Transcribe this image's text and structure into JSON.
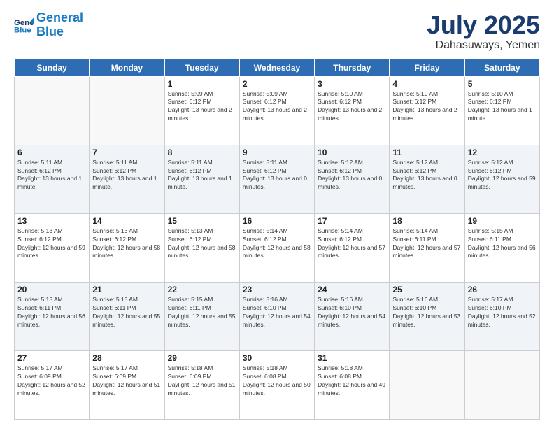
{
  "logo": {
    "line1": "General",
    "line2": "Blue"
  },
  "title": "July 2025",
  "subtitle": "Dahasuways, Yemen",
  "days_header": [
    "Sunday",
    "Monday",
    "Tuesday",
    "Wednesday",
    "Thursday",
    "Friday",
    "Saturday"
  ],
  "weeks": [
    [
      {
        "num": "",
        "info": ""
      },
      {
        "num": "",
        "info": ""
      },
      {
        "num": "1",
        "info": "Sunrise: 5:09 AM\nSunset: 6:12 PM\nDaylight: 13 hours and 2 minutes."
      },
      {
        "num": "2",
        "info": "Sunrise: 5:09 AM\nSunset: 6:12 PM\nDaylight: 13 hours and 2 minutes."
      },
      {
        "num": "3",
        "info": "Sunrise: 5:10 AM\nSunset: 6:12 PM\nDaylight: 13 hours and 2 minutes."
      },
      {
        "num": "4",
        "info": "Sunrise: 5:10 AM\nSunset: 6:12 PM\nDaylight: 13 hours and 2 minutes."
      },
      {
        "num": "5",
        "info": "Sunrise: 5:10 AM\nSunset: 6:12 PM\nDaylight: 13 hours and 1 minute."
      }
    ],
    [
      {
        "num": "6",
        "info": "Sunrise: 5:11 AM\nSunset: 6:12 PM\nDaylight: 13 hours and 1 minute."
      },
      {
        "num": "7",
        "info": "Sunrise: 5:11 AM\nSunset: 6:12 PM\nDaylight: 13 hours and 1 minute."
      },
      {
        "num": "8",
        "info": "Sunrise: 5:11 AM\nSunset: 6:12 PM\nDaylight: 13 hours and 1 minute."
      },
      {
        "num": "9",
        "info": "Sunrise: 5:11 AM\nSunset: 6:12 PM\nDaylight: 13 hours and 0 minutes."
      },
      {
        "num": "10",
        "info": "Sunrise: 5:12 AM\nSunset: 6:12 PM\nDaylight: 13 hours and 0 minutes."
      },
      {
        "num": "11",
        "info": "Sunrise: 5:12 AM\nSunset: 6:12 PM\nDaylight: 13 hours and 0 minutes."
      },
      {
        "num": "12",
        "info": "Sunrise: 5:12 AM\nSunset: 6:12 PM\nDaylight: 12 hours and 59 minutes."
      }
    ],
    [
      {
        "num": "13",
        "info": "Sunrise: 5:13 AM\nSunset: 6:12 PM\nDaylight: 12 hours and 59 minutes."
      },
      {
        "num": "14",
        "info": "Sunrise: 5:13 AM\nSunset: 6:12 PM\nDaylight: 12 hours and 58 minutes."
      },
      {
        "num": "15",
        "info": "Sunrise: 5:13 AM\nSunset: 6:12 PM\nDaylight: 12 hours and 58 minutes."
      },
      {
        "num": "16",
        "info": "Sunrise: 5:14 AM\nSunset: 6:12 PM\nDaylight: 12 hours and 58 minutes."
      },
      {
        "num": "17",
        "info": "Sunrise: 5:14 AM\nSunset: 6:12 PM\nDaylight: 12 hours and 57 minutes."
      },
      {
        "num": "18",
        "info": "Sunrise: 5:14 AM\nSunset: 6:11 PM\nDaylight: 12 hours and 57 minutes."
      },
      {
        "num": "19",
        "info": "Sunrise: 5:15 AM\nSunset: 6:11 PM\nDaylight: 12 hours and 56 minutes."
      }
    ],
    [
      {
        "num": "20",
        "info": "Sunrise: 5:15 AM\nSunset: 6:11 PM\nDaylight: 12 hours and 56 minutes."
      },
      {
        "num": "21",
        "info": "Sunrise: 5:15 AM\nSunset: 6:11 PM\nDaylight: 12 hours and 55 minutes."
      },
      {
        "num": "22",
        "info": "Sunrise: 5:15 AM\nSunset: 6:11 PM\nDaylight: 12 hours and 55 minutes."
      },
      {
        "num": "23",
        "info": "Sunrise: 5:16 AM\nSunset: 6:10 PM\nDaylight: 12 hours and 54 minutes."
      },
      {
        "num": "24",
        "info": "Sunrise: 5:16 AM\nSunset: 6:10 PM\nDaylight: 12 hours and 54 minutes."
      },
      {
        "num": "25",
        "info": "Sunrise: 5:16 AM\nSunset: 6:10 PM\nDaylight: 12 hours and 53 minutes."
      },
      {
        "num": "26",
        "info": "Sunrise: 5:17 AM\nSunset: 6:10 PM\nDaylight: 12 hours and 52 minutes."
      }
    ],
    [
      {
        "num": "27",
        "info": "Sunrise: 5:17 AM\nSunset: 6:09 PM\nDaylight: 12 hours and 52 minutes."
      },
      {
        "num": "28",
        "info": "Sunrise: 5:17 AM\nSunset: 6:09 PM\nDaylight: 12 hours and 51 minutes."
      },
      {
        "num": "29",
        "info": "Sunrise: 5:18 AM\nSunset: 6:09 PM\nDaylight: 12 hours and 51 minutes."
      },
      {
        "num": "30",
        "info": "Sunrise: 5:18 AM\nSunset: 6:08 PM\nDaylight: 12 hours and 50 minutes."
      },
      {
        "num": "31",
        "info": "Sunrise: 5:18 AM\nSunset: 6:08 PM\nDaylight: 12 hours and 49 minutes."
      },
      {
        "num": "",
        "info": ""
      },
      {
        "num": "",
        "info": ""
      }
    ]
  ]
}
